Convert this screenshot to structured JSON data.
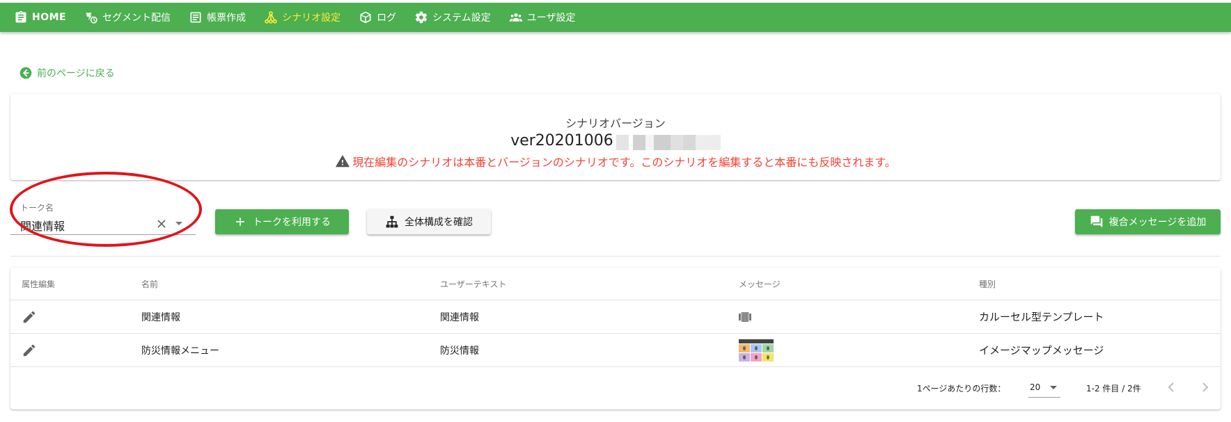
{
  "nav": {
    "items": [
      {
        "label": "HOME",
        "icon": "clipboard-icon"
      },
      {
        "label": "セグメント配信",
        "icon": "segment-send-icon"
      },
      {
        "label": "帳票作成",
        "icon": "form-icon"
      },
      {
        "label": "シナリオ設定",
        "icon": "scenario-icon",
        "active": true
      },
      {
        "label": "ログ",
        "icon": "cube-icon"
      },
      {
        "label": "システム設定",
        "icon": "gear-icon"
      },
      {
        "label": "ユーザ設定",
        "icon": "users-icon"
      }
    ]
  },
  "back": {
    "label": "前のページに戻る"
  },
  "version": {
    "label": "シナリオバージョン",
    "value": "ver20201006",
    "warning": "現在編集のシナリオは本番とバージョンのシナリオです。このシナリオを編集すると本番にも反映されます。"
  },
  "toolbar": {
    "talk_label": "トーク名",
    "talk_value": "関連情報",
    "use_button": "トークを利用する",
    "structure_button": "全体構成を確認",
    "add_button": "複合メッセージを追加"
  },
  "table": {
    "headers": [
      "属性編集",
      "名前",
      "ユーザーテキスト",
      "メッセージ",
      "種別"
    ],
    "rows": [
      {
        "name": "関連情報",
        "user_text": "関連情報",
        "message_icon": "carousel-icon",
        "type": "カルーセル型テンプレート"
      },
      {
        "name": "防災情報メニュー",
        "user_text": "防災情報",
        "message_icon": "imagemap-thumbnail",
        "type": "イメージマップメッセージ"
      }
    ],
    "footer": {
      "rows_per_page_label": "1ページあたりの行数：",
      "rows_per_page": "20",
      "range": "1-2 件目 / 2件"
    }
  },
  "colors": {
    "primary": "#4caf50",
    "active_nav": "#ffeb3b",
    "warning": "#f44336",
    "highlight_ring": "#e0151b"
  }
}
